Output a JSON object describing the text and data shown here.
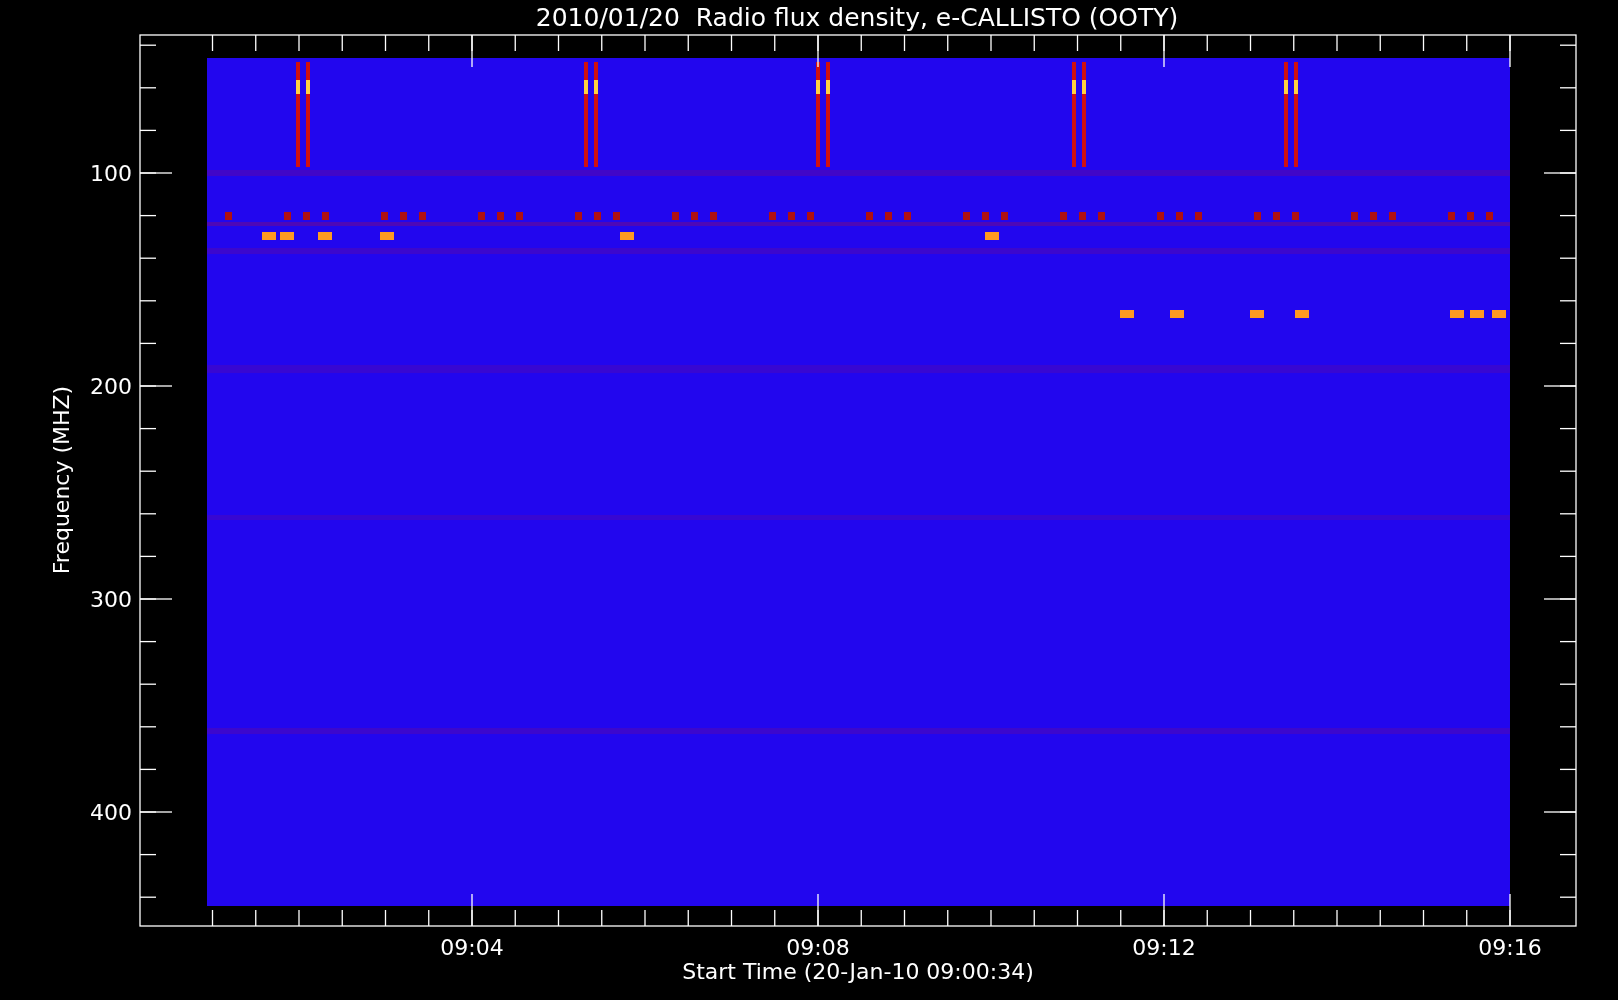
{
  "title": "2010/01/20  Radio flux density, e-CALLISTO (OOTY)",
  "y_axis": {
    "label": "Frequency (MHZ)",
    "ticks": [
      "100",
      "200",
      "300",
      "400"
    ]
  },
  "x_axis": {
    "label": "Start Time (20-Jan-10 09:00:34)",
    "ticks": [
      "09:04",
      "09:08",
      "09:12",
      "09:16"
    ]
  }
}
